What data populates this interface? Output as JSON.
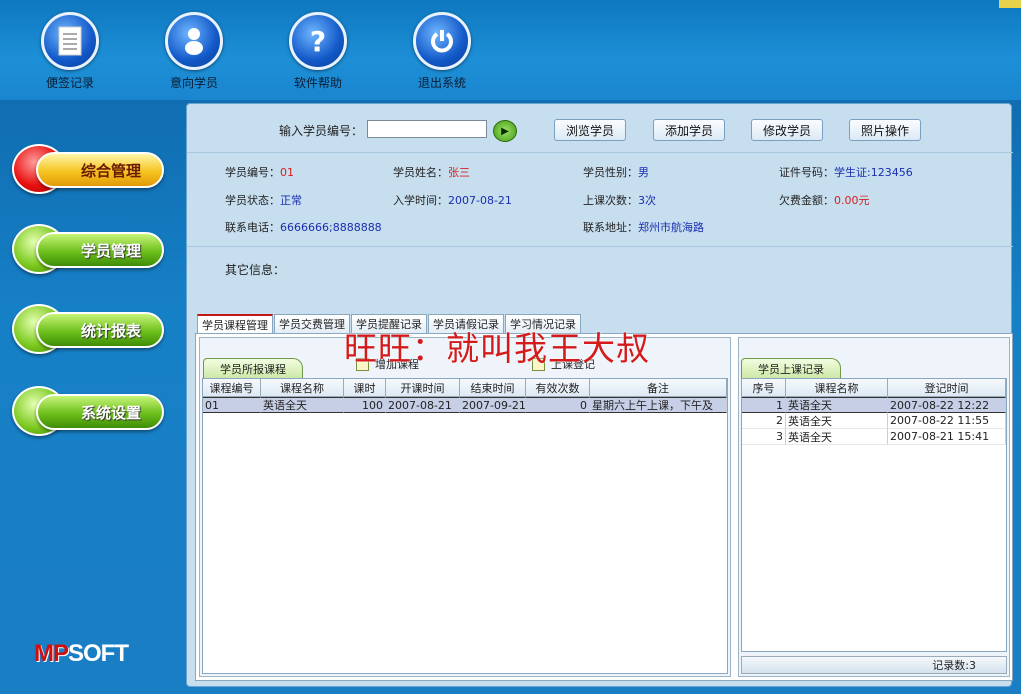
{
  "toolbar": {
    "items": [
      {
        "label": "便签记录",
        "icon": "notepad-icon"
      },
      {
        "label": "意向学员",
        "icon": "person-icon"
      },
      {
        "label": "软件帮助",
        "icon": "help-icon"
      },
      {
        "label": "退出系统",
        "icon": "power-icon"
      }
    ]
  },
  "sidebar": {
    "items": [
      {
        "label": "综合管理",
        "active": true
      },
      {
        "label": "学员管理"
      },
      {
        "label": "统计报表"
      },
      {
        "label": "系统设置"
      }
    ],
    "logo_mp": "MP",
    "logo_soft": "SOFT"
  },
  "search": {
    "label": "输入学员编号：",
    "value": "",
    "go_icon": "play-arrow-icon",
    "buttons": [
      "浏览学员",
      "添加学员",
      "修改学员",
      "照片操作"
    ]
  },
  "student": {
    "id_k": "学员编号：",
    "id_v": "01",
    "name_k": "学员姓名：",
    "name_v": "张三",
    "gender_k": "学员性别：",
    "gender_v": "男",
    "cert_k": "证件号码：",
    "cert_v": "学生证:123456",
    "status_k": "学员状态：",
    "status_v": "正常",
    "enroll_k": "入学时间：",
    "enroll_v": "2007-08-21",
    "classes_k": "上课次数：",
    "classes_v": "3次",
    "owed_k": "欠费金额：",
    "owed_v": "0.00元",
    "phone_k": "联系电话：",
    "phone_v": "6666666;8888888",
    "addr_k": "联系地址：",
    "addr_v": "郑州市航海路",
    "other_k": "其它信息："
  },
  "tabs": [
    "学员课程管理",
    "学员交费管理",
    "学员提醒记录",
    "学员请假记录",
    "学习情况记录"
  ],
  "courses": {
    "title": "学员所报课程",
    "add_label": "增加课程",
    "checkin_label": "上课登记",
    "headers": [
      "课程编号",
      "课程名称",
      "课时",
      "开课时间",
      "结束时间",
      "有效次数",
      "备注"
    ],
    "rows": [
      [
        "01",
        "英语全天",
        "100",
        "2007-08-21",
        "2007-09-21",
        "0",
        "星期六上午上课，下午及"
      ]
    ]
  },
  "attendance": {
    "title": "学员上课记录",
    "headers": [
      "序号",
      "课程名称",
      "登记时间"
    ],
    "rows": [
      [
        "1",
        "英语全天",
        "2007-08-22 12:22"
      ],
      [
        "2",
        "英语全天",
        "2007-08-22 11:55"
      ],
      [
        "3",
        "英语全天",
        "2007-08-21 15:41"
      ]
    ],
    "footer": "记录数:3"
  },
  "watermark": "旺旺：就叫我王大叔"
}
